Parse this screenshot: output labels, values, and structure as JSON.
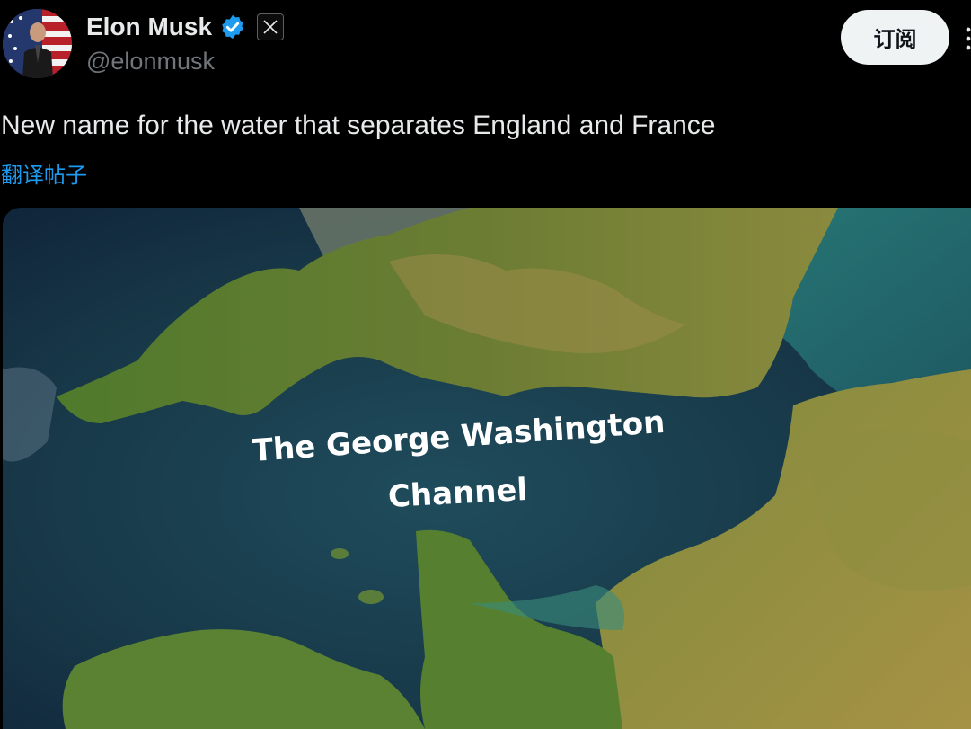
{
  "author": {
    "name": "Elon Musk",
    "handle": "@elonmusk",
    "avatar_icon": "profile-photo",
    "verified_icon": "verified-badge-icon",
    "affiliate_icon": "x-logo-icon"
  },
  "actions": {
    "subscribe_label": "订阅",
    "more_icon": "more-vertical-icon"
  },
  "post": {
    "text": "New name for the water that separates England and France",
    "translate_label": "翻译帖子"
  },
  "media": {
    "caption_line1": "The George Washington",
    "caption_line2": "Channel"
  },
  "colors": {
    "background": "#000000",
    "link": "#1d9bf0",
    "verified": "#1d9bf0",
    "button_bg": "#eff3f4",
    "muted_text": "#71767b"
  }
}
